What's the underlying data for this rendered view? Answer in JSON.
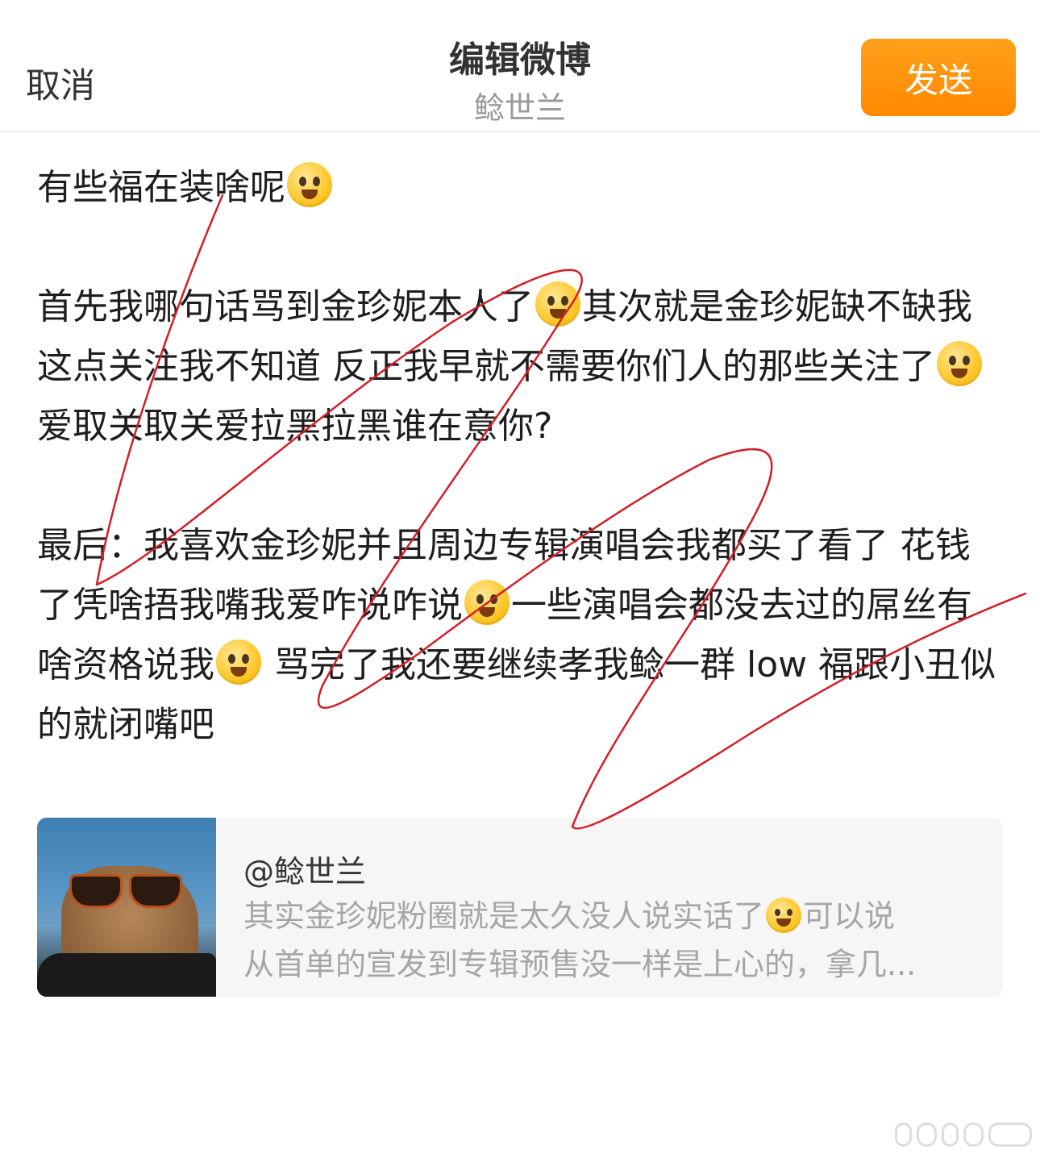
{
  "header": {
    "cancel_label": "取消",
    "title": "编辑微博",
    "subtitle": "鲶世兰",
    "send_label": "发送"
  },
  "post": {
    "line1": "有些福在装啥呢",
    "para2_part1": "首先我哪句话骂到金珍妮本人了",
    "para2_part2": "其次就是金珍妮缺不缺我这点关注我不知道 反正我早就不需要你们人的那些关注了",
    "para2_part3": "爱取关取关爱拉黑拉黑谁在意你?",
    "para3_part1": "最后：我喜欢金珍妮并且周边专辑演唱会我都买了看了 花钱了凭啥捂我嘴我爱咋说咋说",
    "para3_part2": "一些演唱会都没去过的屌丝有啥资格说我",
    "para3_part3": " 骂完了我还要继续孝我鲶一群 low 福跟小丑似的就闭嘴吧"
  },
  "quoted": {
    "user": "@鲶世兰",
    "text_part1": "其实金珍妮粉圈就是太久没人说实话了",
    "text_part2": "可以说",
    "line2": "从首单的宣发到专辑预售没一样是上心的，拿几..."
  },
  "icons": {
    "emoji_1": "flushed-emoji",
    "emoji_2": "confused-emoji",
    "emoji_3": "laugh-cry-emoji",
    "emoji_4": "blushing-emoji",
    "emoji_5": "crying-emoji"
  },
  "colors": {
    "send_button": "#ff8c00",
    "scribble": "#d21e28"
  }
}
